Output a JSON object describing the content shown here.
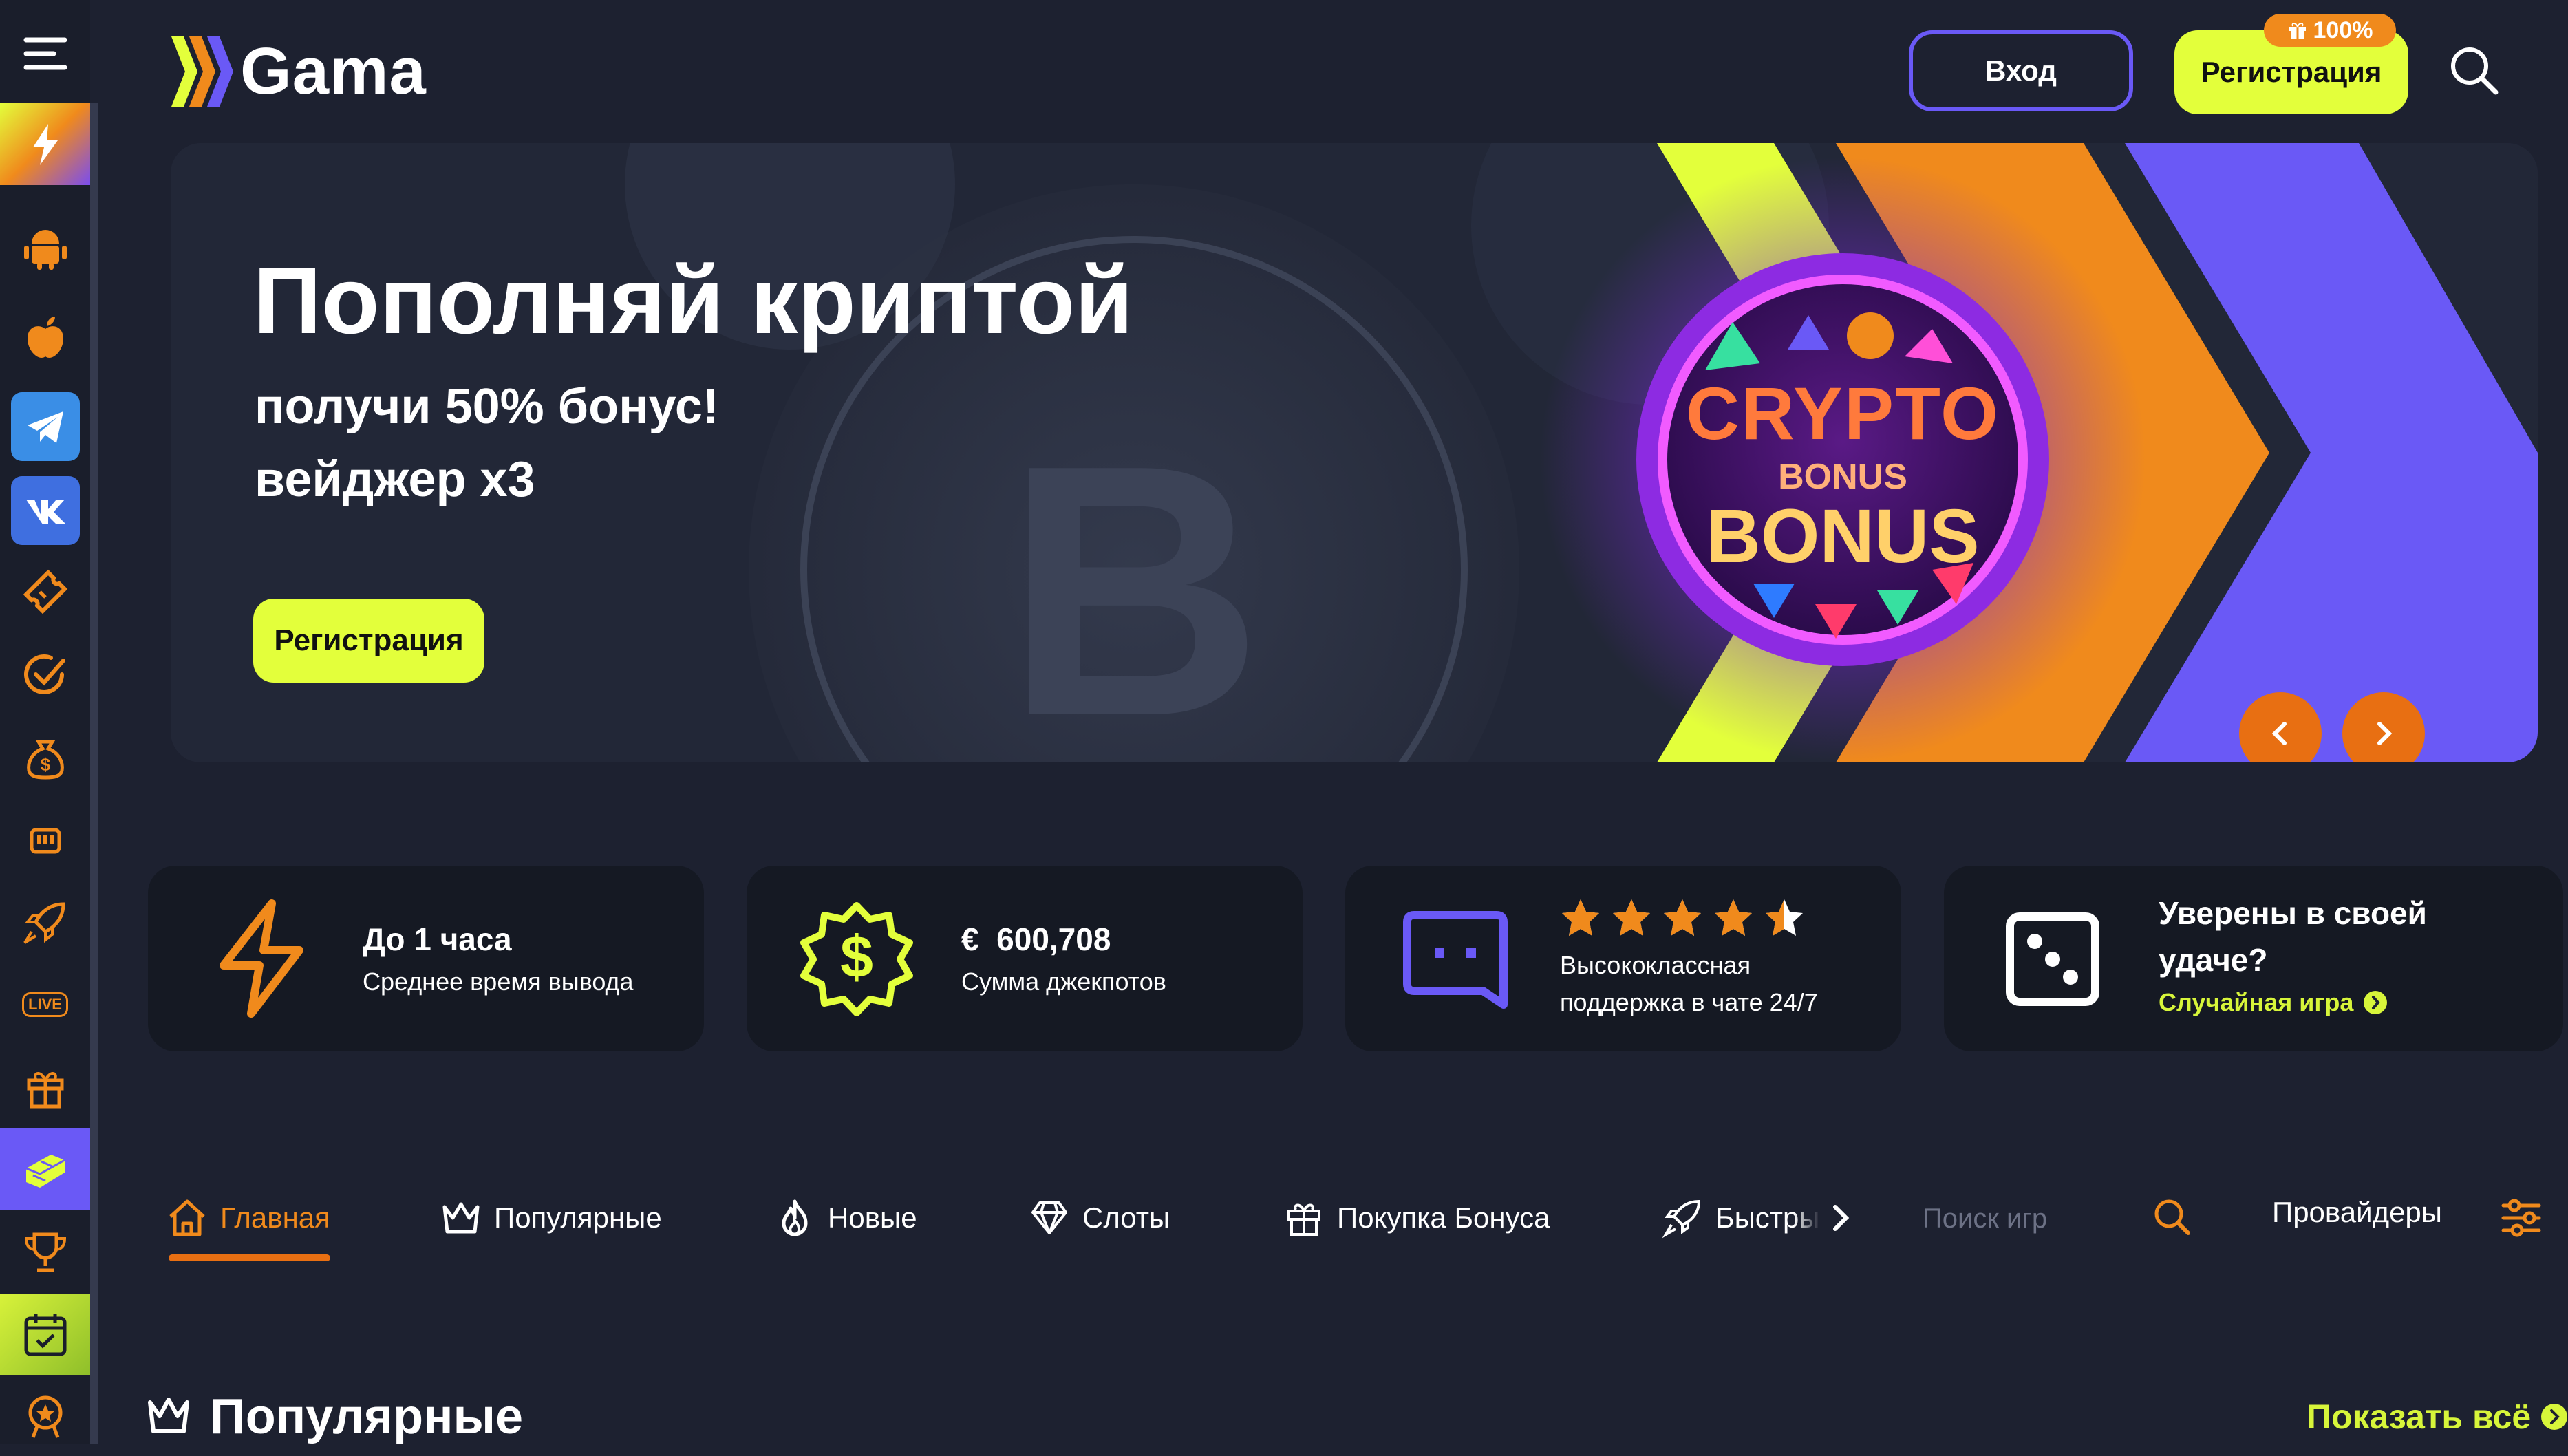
{
  "header": {
    "logo_text": "Gama",
    "login_label": "Вход",
    "register_label": "Регистрация",
    "register_badge": "100%"
  },
  "sidebar": {
    "items": [
      {
        "icon": "menu-icon"
      },
      {
        "icon": "lightning-icon"
      },
      {
        "icon": "android-icon"
      },
      {
        "icon": "apple-icon"
      },
      {
        "icon": "telegram-icon"
      },
      {
        "icon": "vk-icon"
      },
      {
        "icon": "ticket-icon"
      },
      {
        "icon": "check-circle-icon"
      },
      {
        "icon": "money-bag-icon"
      },
      {
        "icon": "slot-machine-icon"
      },
      {
        "icon": "rocket-icon"
      },
      {
        "label": "LIVE"
      },
      {
        "icon": "gift-icon"
      },
      {
        "icon": "stairs-icon"
      },
      {
        "icon": "trophy-icon"
      },
      {
        "icon": "calendar-check-icon"
      },
      {
        "icon": "award-icon"
      }
    ]
  },
  "banner": {
    "title": "Пополняй криптой",
    "subtitle1": "получи 50% бонус!",
    "subtitle2": "вейджер x3",
    "button": "Регистрация",
    "art_line1": "CRYPTO",
    "art_line2": "BONUS",
    "art_line3": "BONUS"
  },
  "stats": [
    {
      "title": "До 1 часа",
      "subtitle": "Среднее время вывода",
      "icon": "lightning-icon"
    },
    {
      "currency": "€",
      "title": "600,708",
      "subtitle": "Сумма джекпотов",
      "icon": "dollar-badge-icon"
    },
    {
      "rating": 4.5,
      "rating_max": 5,
      "subtitle_line1": "Высококлассная",
      "subtitle_line2": "поддержка в чате 24/7",
      "icon": "chat-icon"
    },
    {
      "title_line1": "Уверены в своей",
      "title_line2": "удаче?",
      "link": "Случайная игра",
      "icon": "dice-icon"
    }
  ],
  "tabs": [
    {
      "label": "Главная",
      "icon": "home-icon",
      "active": true
    },
    {
      "label": "Популярные",
      "icon": "crown-icon"
    },
    {
      "label": "Новые",
      "icon": "fire-icon"
    },
    {
      "label": "Слоты",
      "icon": "diamond-icon"
    },
    {
      "label": "Покупка Бонуса",
      "icon": "gift-icon"
    },
    {
      "label": "Быстры",
      "icon": "rocket-icon"
    }
  ],
  "search": {
    "placeholder": "Поиск игр"
  },
  "providers_label": "Провайдеры",
  "section": {
    "title": "Популярные",
    "show_all": "Показать всё"
  },
  "colors": {
    "background": "#1d2130",
    "card": "#151923",
    "accent_yellow": "#e3ff3b",
    "accent_orange": "#e86f12",
    "accent_purple": "#6a59f6"
  }
}
